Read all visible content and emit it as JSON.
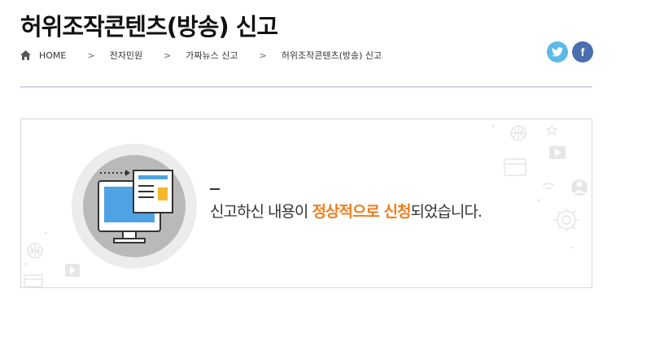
{
  "page": {
    "title": "허위조작콘텐츠(방송) 신고"
  },
  "breadcrumb": {
    "home_icon": "home-icon",
    "items": [
      "HOME",
      "전자민원",
      "가짜뉴스 신고",
      "허위조작콘텐츠(방송) 신고"
    ],
    "separator": ">"
  },
  "social": {
    "twitter_icon": "twitter-icon",
    "facebook_icon": "facebook-icon",
    "facebook_glyph": "f",
    "colors": {
      "twitter": "#5db9e8",
      "facebook": "#4a6fb0"
    }
  },
  "result": {
    "message_prefix": "신고하신 내용이 ",
    "message_highlight": "정상적으로 신청",
    "message_suffix": "되었습니다.",
    "highlight_color": "#f07d1d"
  }
}
